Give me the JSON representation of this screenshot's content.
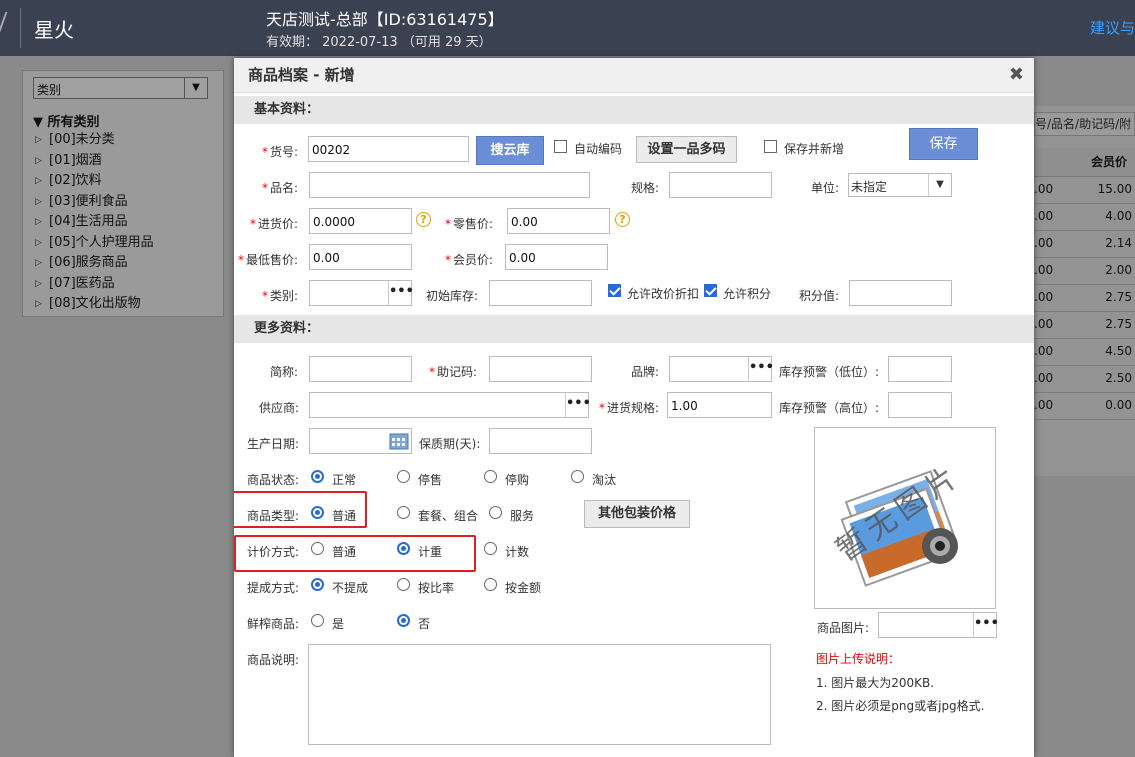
{
  "topbar": {
    "app_name": "星火",
    "store": "天店测试-总部【ID:63161475】",
    "validity": "有效期：  2022-07-13  （可用 29 天）",
    "feedback": "建议与"
  },
  "left_panel": {
    "category_select": "类别",
    "tree_root": "所有类别",
    "tree_items": [
      "[00]未分类",
      "[01]烟酒",
      "[02]饮料",
      "[03]便利食品",
      "[04]生活用品",
      "[05]个人护理用品",
      "[06]服务商品",
      "[07]医药品",
      "[08]文化出版物"
    ]
  },
  "right_panel": {
    "search_hint": "号/品名/助记码/附",
    "col_header": "会员价",
    "rows": [
      {
        "c1": ".00",
        "c2": "15.00"
      },
      {
        "c1": ".00",
        "c2": "4.00"
      },
      {
        "c1": ".00",
        "c2": "2.14"
      },
      {
        "c1": ".00",
        "c2": "2.00"
      },
      {
        "c1": ".00",
        "c2": "2.75"
      },
      {
        "c1": ".00",
        "c2": "2.75"
      },
      {
        "c1": ".00",
        "c2": "4.50"
      },
      {
        "c1": ".00",
        "c2": "2.50"
      },
      {
        "c1": ".00",
        "c2": "0.00"
      }
    ]
  },
  "modal": {
    "title": "商品档案 - 新增",
    "close": "✖",
    "section_basic": "基本资料：",
    "section_more": "更多资料：",
    "labels": {
      "code": "货号:",
      "name": "品名:",
      "spec": "规格:",
      "unit": "单位:",
      "purchase_price": "进货价:",
      "retail_price": "零售价:",
      "min_price": "最低售价:",
      "member_price": "会员价:",
      "category": "类别:",
      "initial_stock": "初始库存:",
      "points_value": "积分值:",
      "short_name": "简称:",
      "mnemonic": "助记码:",
      "brand": "品牌:",
      "stock_low": "库存预警（低位）:",
      "supplier": "供应商:",
      "purchase_spec": "进货规格:",
      "stock_high": "库存预警（高位）:",
      "prod_date": "生产日期:",
      "shelf_life": "保质期(天):",
      "status": "商品状态:",
      "type": "商品类型:",
      "pricing": "计价方式:",
      "commission": "提成方式:",
      "fresh": "鲜榨商品:",
      "desc": "商品说明:",
      "image": "商品图片:"
    },
    "values": {
      "code": "00202",
      "purchase_price": "0.0000",
      "retail_price": "0.00",
      "min_price": "0.00",
      "member_price": "0.00",
      "unit": "未指定",
      "purchase_spec": "1.00"
    },
    "buttons": {
      "search_cloud": "搜云库",
      "auto_code": "自动编码",
      "multi_code": "设置一品多码",
      "save_add": "保存并新增",
      "save": "保存",
      "other_pack": "其他包装价格",
      "dots": "•••"
    },
    "checks": {
      "allow_discount": "允许改价折扣",
      "allow_points": "允许积分"
    },
    "status_opts": [
      "正常",
      "停售",
      "停购",
      "淘汰"
    ],
    "type_opts": [
      "普通",
      "套餐、组合",
      "服务"
    ],
    "pricing_opts": [
      "普通",
      "计重",
      "计数"
    ],
    "commission_opts": [
      "不提成",
      "按比率",
      "按金额"
    ],
    "fresh_opts": [
      "是",
      "否"
    ],
    "image_watermark": "暂无图片",
    "upload_note_title": "图片上传说明：",
    "upload_notes": [
      "1. 图片最大为200KB.",
      "2. 图片必须是png或者jpg格式."
    ],
    "help_icon": "?"
  },
  "colors": {
    "accent": "#6b8ed6",
    "required": "#e00000",
    "highlight_box": "#e02020",
    "topbar": "#3a4150"
  }
}
